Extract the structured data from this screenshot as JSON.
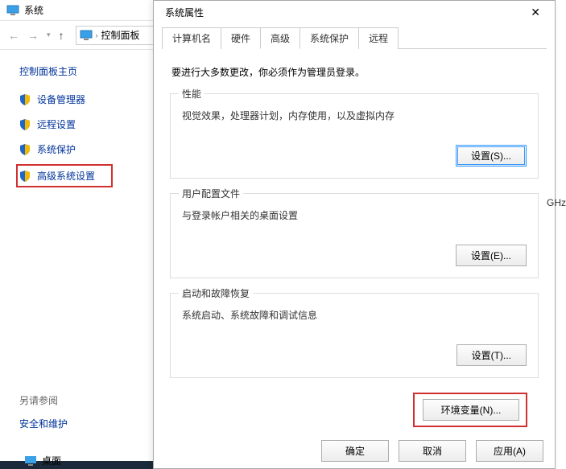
{
  "system_window": {
    "title": "系统",
    "breadcrumb": "控制面板",
    "sidebar_title": "控制面板主页",
    "sidebar_items": [
      {
        "label": "设备管理器"
      },
      {
        "label": "远程设置"
      },
      {
        "label": "系统保护"
      },
      {
        "label": "高级系统设置"
      }
    ],
    "see_also_title": "另请参阅",
    "see_also_link": "安全和维护",
    "bottom_label": "桌面"
  },
  "dialog": {
    "title": "系统属性",
    "tabs": [
      "计算机名",
      "硬件",
      "高级",
      "系统保护",
      "远程"
    ],
    "active_tab": 2,
    "admin_text": "要进行大多数更改，你必须作为管理员登录。",
    "groups": {
      "performance": {
        "title": "性能",
        "desc": "视觉效果，处理器计划，内存使用，以及虚拟内存",
        "button": "设置(S)..."
      },
      "user_profiles": {
        "title": "用户配置文件",
        "desc": "与登录帐户相关的桌面设置",
        "button": "设置(E)..."
      },
      "startup": {
        "title": "启动和故障恢复",
        "desc": "系统启动、系统故障和调试信息",
        "button": "设置(T)..."
      }
    },
    "env_var_button": "环境变量(N)...",
    "ok_button": "确定",
    "cancel_button": "取消",
    "apply_button": "应用(A)"
  },
  "right_edge": {
    "ghz": "GHz"
  }
}
